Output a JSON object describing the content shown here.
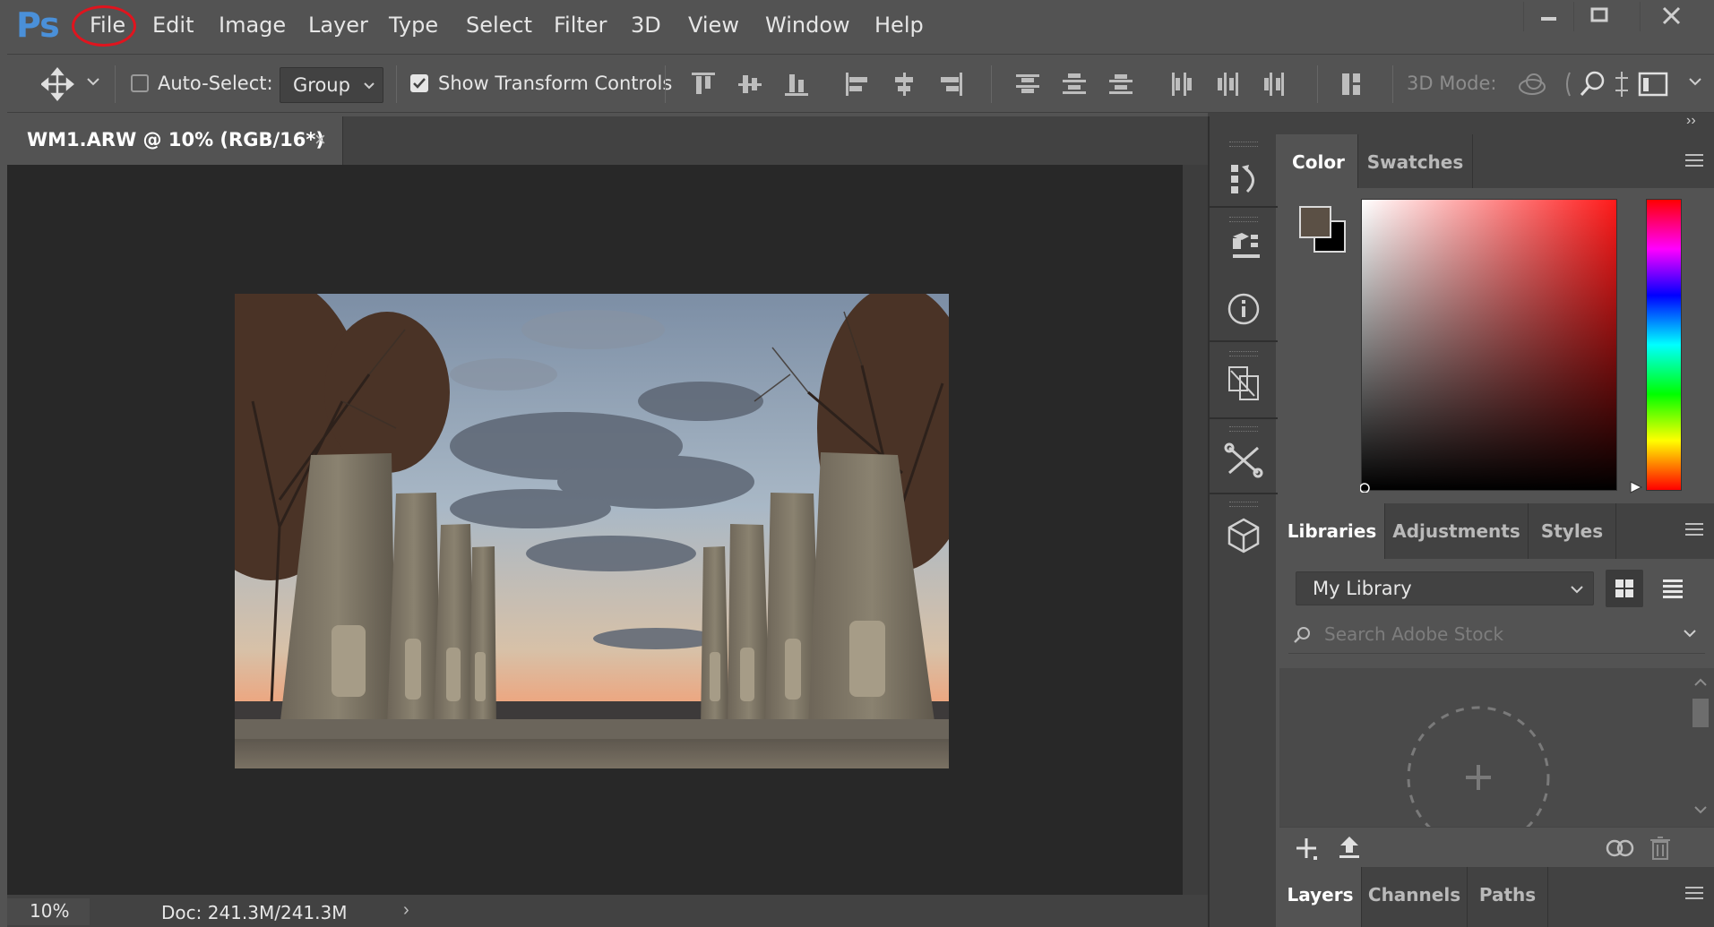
{
  "app": {
    "logo": "Ps",
    "menu": [
      "File",
      "Edit",
      "Image",
      "Layer",
      "Type",
      "Select",
      "Filter",
      "3D",
      "View",
      "Window",
      "Help"
    ],
    "highlighted_menu": "File",
    "highlight_color": "#e0141e"
  },
  "options_bar": {
    "auto_select_label": "Auto-Select:",
    "auto_select_checked": false,
    "group_value": "Group",
    "show_transform_label": "Show Transform Controls",
    "show_transform_checked": true,
    "mode_label": "3D Mode:"
  },
  "document": {
    "tab_title": "WM1.ARW @ 10% (RGB/16*)",
    "tab_close": "×",
    "zoom": "10%",
    "doc_info": "Doc: 241.3M/241.3M",
    "status_arrow": "›"
  },
  "panels": {
    "group1_tabs": [
      "Color",
      "Swatches"
    ],
    "group1_active": "Color",
    "foreground_color": "#5b5045",
    "background_color": "#000000",
    "group2_tabs": [
      "Libraries",
      "Adjustments",
      "Styles"
    ],
    "group2_active": "Libraries",
    "library_select": "My Library",
    "stock_search_placeholder": "Search Adobe Stock",
    "group3_tabs": [
      "Layers",
      "Channels",
      "Paths"
    ],
    "group3_active": "Layers"
  },
  "collapse": {
    "left": "‹‹",
    "right": "››"
  }
}
